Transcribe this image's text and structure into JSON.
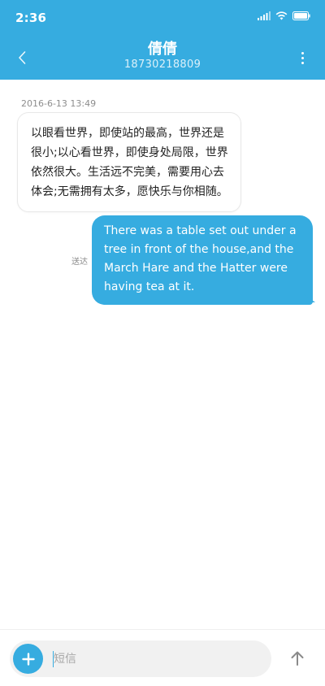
{
  "status_bar": {
    "time": "2:36",
    "icons": [
      "signal-icon",
      "wifi-icon",
      "battery-icon"
    ]
  },
  "header": {
    "contact_name": "倩倩",
    "contact_number": "18730218809",
    "back_icon": "back-icon",
    "more_icon": "more-vertical-icon"
  },
  "conversation": {
    "timestamp": "2016-6-13 13:49",
    "incoming_message": "以眼看世界，即使站的最高，世界还是很小;以心看世界，即使身处局限，世界依然很大。生活远不完美，需要用心去体会;无需拥有太多，愿快乐与你相随。",
    "outgoing_message": "There was a table set out under a tree in front of the house,and the March Hare and the Hatter were having tea at it.",
    "delivery_status": "送达"
  },
  "composer": {
    "placeholder": "短信",
    "value": "",
    "add_icon": "plus-icon",
    "send_icon": "arrow-up-icon"
  },
  "colors": {
    "accent": "#36ace0",
    "incoming_bubble": "#ffffff",
    "outgoing_bubble": "#36ace0",
    "meta_text": "#8d8d8d"
  }
}
